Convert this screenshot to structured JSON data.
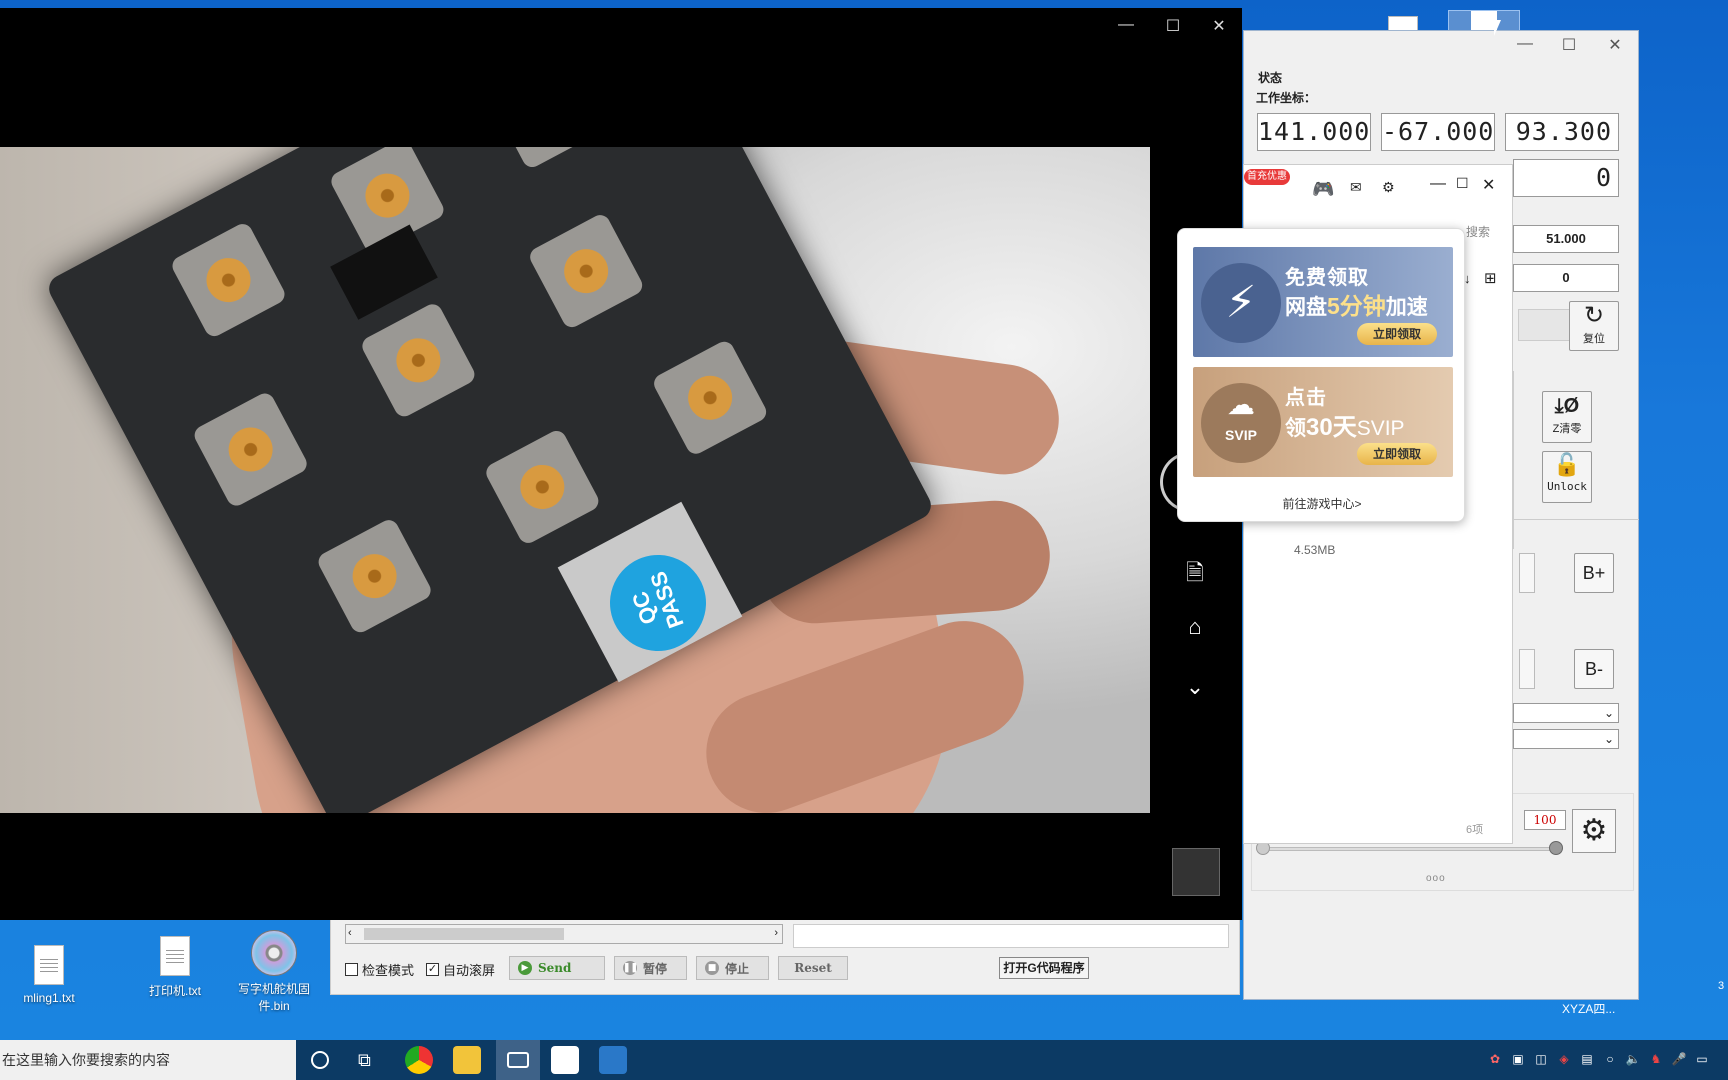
{
  "desktop": {
    "icons": [
      {
        "label": "mling1.txt"
      },
      {
        "label": "打印机.txt"
      },
      {
        "label": "写字机舵机固件.bin"
      }
    ],
    "corner_label": "XYZA四..."
  },
  "controller": {
    "status_title": "状态",
    "work_coord_label": "工作坐标：",
    "coords": {
      "x": "141.000",
      "y": "-67.000",
      "z": "93.300"
    },
    "a_value": "0",
    "speed_value": "51.000",
    "field_value": "0",
    "reset_label": "复位",
    "z_zero_label": "Z清零",
    "unlock_label": "Unlock",
    "b_plus": "B+",
    "b_minus": "B-",
    "slider_value": "100",
    "dots": "ooo"
  },
  "bottom_panel": {
    "check_mode": "检查模式",
    "auto_scroll": "自动滚屏",
    "send": "Send",
    "pause": "暂停",
    "stop": "停止",
    "reset": "Reset",
    "open_gcode": "打开G代码程序"
  },
  "netdisk": {
    "badge": "首充优惠",
    "search_placeholder": "搜索",
    "file_size": "4.53MB",
    "item_count": "6项",
    "ad1": {
      "line1": "免费领取",
      "line2_a": "网盘",
      "line2_b": "5分钟",
      "line2_c": "加速",
      "button": "立即领取"
    },
    "ad2": {
      "line1": "点击",
      "line2_a": "领",
      "line2_b": "30天",
      "line2_c": "SVIP",
      "logo_text": "SVIP",
      "button": "立即领取"
    },
    "game_center": "前往游戏中心>"
  },
  "camera_view": {
    "qc_text": "QC PASS"
  },
  "taskbar": {
    "search_text": "在这里输入你要搜索的内容",
    "clock_partial": "3"
  },
  "colors": {
    "accent": "#1fa3df",
    "taskbar": "#0c3a64",
    "desktop": "#1a84e0"
  }
}
